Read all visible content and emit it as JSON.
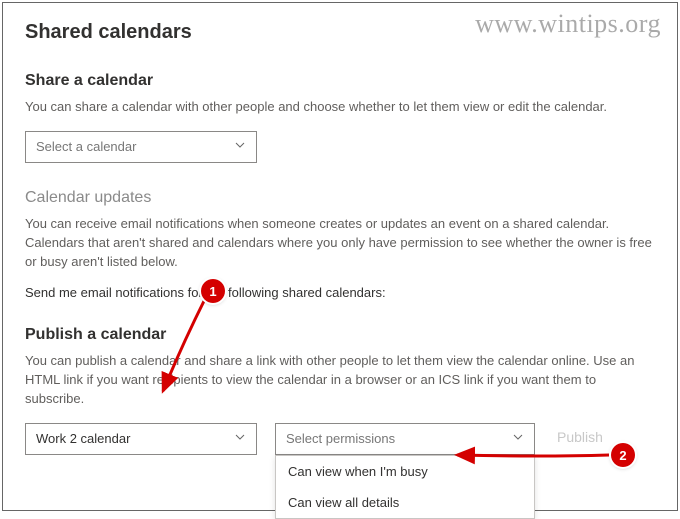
{
  "watermark": "www.wintips.org",
  "page_title": "Shared calendars",
  "share": {
    "title": "Share a calendar",
    "desc": "You can share a calendar with other people and choose whether to let them view or edit the calendar.",
    "dropdown_placeholder": "Select a calendar"
  },
  "updates": {
    "title": "Calendar updates",
    "desc": "You can receive email notifications when someone creates or updates an event on a shared calendar. Calendars that aren't shared and calendars where you only have permission to see whether the owner is free or busy aren't listed below.",
    "sub": "Send me email notifications for the following shared calendars:"
  },
  "publish": {
    "title": "Publish a calendar",
    "desc": "You can publish a calendar and share a link with other people to let them view the calendar online. Use an HTML link if you want recipients to view the calendar in a browser or an ICS link if you want them to subscribe.",
    "calendar_selected": "Work 2 calendar",
    "permissions_placeholder": "Select permissions",
    "button_label": "Publish",
    "options": {
      "opt1": "Can view when I'm busy",
      "opt2": "Can view all details"
    }
  },
  "annotations": {
    "badge1": "1",
    "badge2": "2"
  }
}
